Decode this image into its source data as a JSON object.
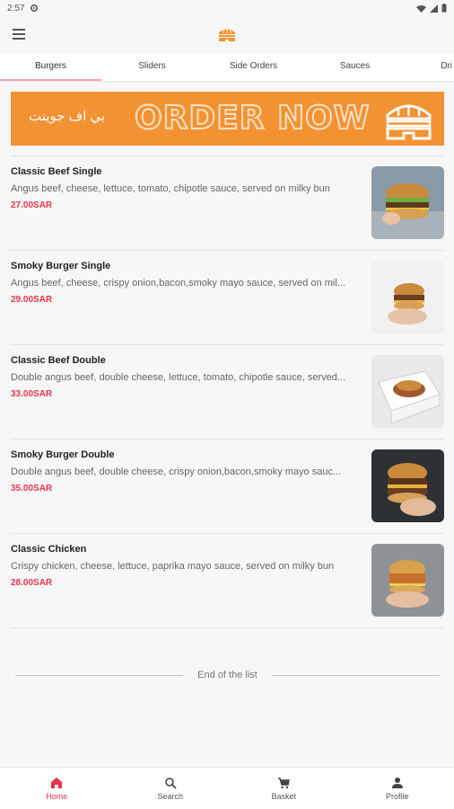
{
  "status_bar": {
    "time": "2:57"
  },
  "tabs": [
    {
      "label": "Burgers",
      "active": true
    },
    {
      "label": "Sliders"
    },
    {
      "label": "Side Orders"
    },
    {
      "label": "Sauces"
    },
    {
      "label": "Dri"
    }
  ],
  "banner": {
    "arabic_text": "بي اف جوينت",
    "title": "ORDER NOW"
  },
  "items": [
    {
      "name": "Classic Beef Single",
      "description": "Angus beef, cheese, lettuce, tomato, chipotle sauce, served on milky bun",
      "price": "27.00SAR"
    },
    {
      "name": "Smoky Burger Single",
      "description": "Angus beef, cheese, crispy onion,bacon,smoky mayo sauce, served on mil...",
      "price": "29.00SAR"
    },
    {
      "name": "Classic Beef Double",
      "description": "Double angus beef, double cheese, lettuce, tomato, chipotle sauce, served...",
      "price": "33.00SAR"
    },
    {
      "name": "Smoky Burger Double",
      "description": "Double angus beef, double cheese, crispy onion,bacon,smoky mayo sauc...",
      "price": "35.00SAR"
    },
    {
      "name": "Classic Chicken",
      "description": "Crispy chicken, cheese, lettuce, paprika mayo sauce, served on milky bun",
      "price": "28.00SAR"
    }
  ],
  "end_of_list": "End of the list",
  "bottom_nav": [
    {
      "label": "Home",
      "icon": "home-icon",
      "active": true
    },
    {
      "label": "Search",
      "icon": "search-icon"
    },
    {
      "label": "Basket",
      "icon": "cart-icon"
    },
    {
      "label": "Profile",
      "icon": "person-icon"
    }
  ],
  "colors": {
    "accent": "#e8334a",
    "banner": "#f39232",
    "tab_indicator": "#f5a3ad"
  }
}
